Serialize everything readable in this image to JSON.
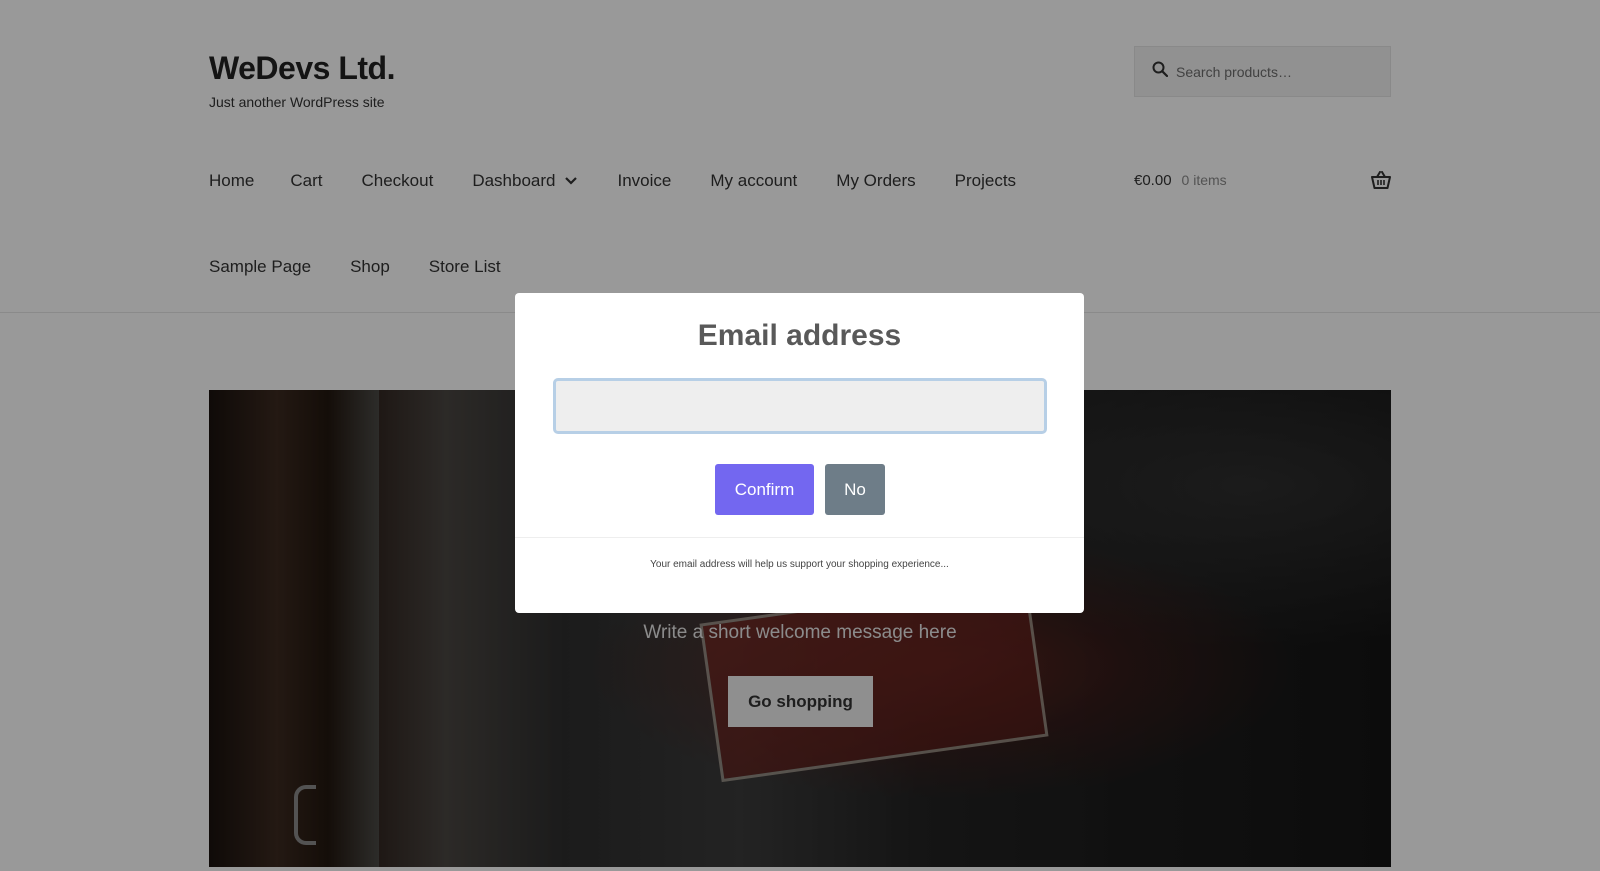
{
  "site": {
    "title": "WeDevs Ltd.",
    "tagline": "Just another WordPress site"
  },
  "search": {
    "placeholder": "Search products…",
    "icon": "search-icon"
  },
  "nav": {
    "row1": [
      "Home",
      "Cart",
      "Checkout",
      "Dashboard",
      "Invoice",
      "My account",
      "My Orders",
      "Projects"
    ],
    "row2": [
      "Sample Page",
      "Shop",
      "Store List"
    ],
    "dropdown_icon": "chevron-down-icon"
  },
  "cart": {
    "amount": "€0.00",
    "count": "0 items",
    "icon": "basket-icon"
  },
  "hero": {
    "message": "Write a short welcome message here",
    "button": "Go shopping"
  },
  "modal": {
    "title": "Email address",
    "input_value": "",
    "confirm_label": "Confirm",
    "no_label": "No",
    "footer_text": "Your email address will help us support your shopping experience...",
    "confirm_color": "#7367f0",
    "no_color": "#6e7d88"
  }
}
